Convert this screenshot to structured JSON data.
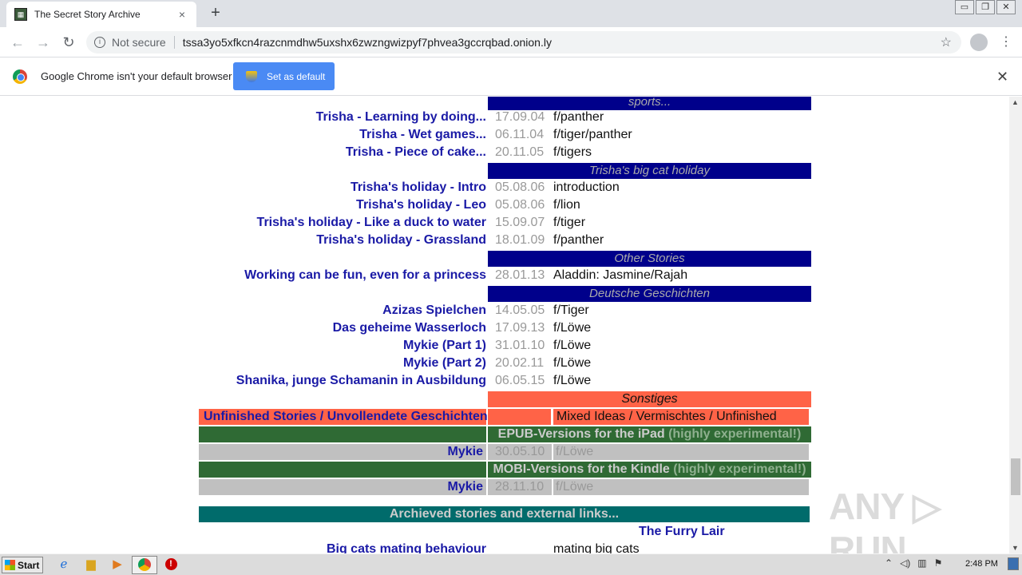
{
  "browser": {
    "tab_title": "The Secret Story Archive",
    "tab_close": "×",
    "new_tab": "+",
    "nav_back": "←",
    "nav_forward": "→",
    "nav_reload": "↻",
    "security_icon": "i",
    "security_label": "Not secure",
    "url": "tssa3yo5xfkcn4razcnmdhw5uxshx6zwzngwizpyf7phvea3gccrqbad.onion.ly",
    "bookmark_star": "☆",
    "menu": "⋮",
    "window_controls": {
      "minimize": "▭",
      "restore": "❐",
      "close": "✕"
    }
  },
  "infobar": {
    "message": "Google Chrome isn't your default browser",
    "button": "Set as default",
    "close": "✕"
  },
  "sections": {
    "sports": "sports...",
    "holiday": "Trisha's big cat holiday",
    "other": "Other Stories",
    "german": "Deutsche Geschichten",
    "sonstiges": "Sonstiges",
    "archived": "Archieved stories and external links..."
  },
  "stories": [
    {
      "title": "Trisha - Learning by doing...",
      "date": "17.09.04",
      "category": "f/panther"
    },
    {
      "title": "Trisha - Wet games...",
      "date": "06.11.04",
      "category": "f/tiger/panther"
    },
    {
      "title": "Trisha - Piece of cake...",
      "date": "20.11.05",
      "category": "f/tigers"
    },
    {
      "title": "Trisha's holiday - Intro",
      "date": "05.08.06",
      "category": "introduction"
    },
    {
      "title": "Trisha's holiday - Leo",
      "date": "05.08.06",
      "category": "f/lion"
    },
    {
      "title": "Trisha's holiday - Like a duck to water",
      "date": "15.09.07",
      "category": "f/tiger"
    },
    {
      "title": "Trisha's holiday - Grassland",
      "date": "18.01.09",
      "category": "f/panther"
    },
    {
      "title": "Working can be fun, even for a princess",
      "date": "28.01.13",
      "category": "Aladdin: Jasmine/Rajah"
    },
    {
      "title": "Azizas Spielchen",
      "date": "14.05.05",
      "category": "f/Tiger"
    },
    {
      "title": "Das geheime Wasserloch",
      "date": "17.09.13",
      "category": "f/Löwe"
    },
    {
      "title": "Mykie (Part 1)",
      "date": "31.01.10",
      "category": "f/Löwe"
    },
    {
      "title": "Mykie (Part 2)",
      "date": "20.02.11",
      "category": "f/Löwe"
    },
    {
      "title": "Shanika, junge Schamanin in Ausbildung",
      "date": "06.05.15",
      "category": "f/Löwe"
    }
  ],
  "misc": {
    "unfinished": "Unfinished Stories / Unvollendete Geschichten",
    "mixed": "Mixed Ideas / Vermischtes / Unfinished",
    "epub_label": "EPUB-Versions for the iPad",
    "mobi_label": "MOBI-Versions for the Kindle",
    "experimental": "(highly experimental!)",
    "epub_story": "Mykie",
    "epub_date": "30.05.10",
    "epub_cat": "f/Löwe",
    "mobi_story": "Mykie",
    "mobi_date": "28.11.10",
    "mobi_cat": "f/Löwe",
    "furry_lair": "The Furry Lair",
    "big_cats": "Big cats mating behaviour",
    "big_cats_cat": "mating big cats"
  },
  "watermark": "ANY ▷ RUN",
  "taskbar": {
    "start": "Start",
    "clock": "2:48 PM",
    "icons": [
      "ie-icon",
      "folder-icon",
      "media-icon",
      "chrome-icon",
      "stop-icon"
    ]
  },
  "colors": {
    "section_blue": "#00008b",
    "link_blue": "#1a1aa6",
    "tomato": "#ff6347",
    "green": "#2f6a34",
    "teal": "#006b6b"
  }
}
